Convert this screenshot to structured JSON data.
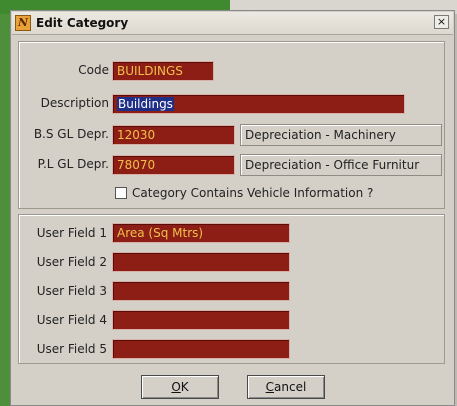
{
  "window": {
    "title": "Edit Category",
    "close_glyph": "×",
    "icon_glyph": "N"
  },
  "form": {
    "code": {
      "label": "Code",
      "value": "BUILDINGS"
    },
    "description": {
      "label": "Description",
      "value": "Buildings"
    },
    "bs_gl": {
      "label": "B.S GL Depr.",
      "value": "12030",
      "desc": "Depreciation - Machinery"
    },
    "pl_gl": {
      "label": "P.L GL Depr.",
      "value": "78070",
      "desc": "Depreciation - Office Furnitur"
    },
    "vehicle_checkbox": {
      "label": "Category Contains Vehicle Information ?",
      "checked": false
    }
  },
  "user_fields": [
    {
      "label": "User Field 1",
      "value": "Area (Sq Mtrs)"
    },
    {
      "label": "User Field 2",
      "value": ""
    },
    {
      "label": "User Field 3",
      "value": ""
    },
    {
      "label": "User Field 4",
      "value": ""
    },
    {
      "label": "User Field 5",
      "value": ""
    }
  ],
  "buttons": {
    "ok": {
      "label": "OK",
      "hotkey": "O",
      "rest": "K"
    },
    "cancel": {
      "label": "Cancel",
      "hotkey": "C",
      "rest": "ancel"
    }
  },
  "colors": {
    "field_bg": "#8d1e16",
    "field_text": "#f2c04a",
    "selection": "#1f2f88"
  }
}
